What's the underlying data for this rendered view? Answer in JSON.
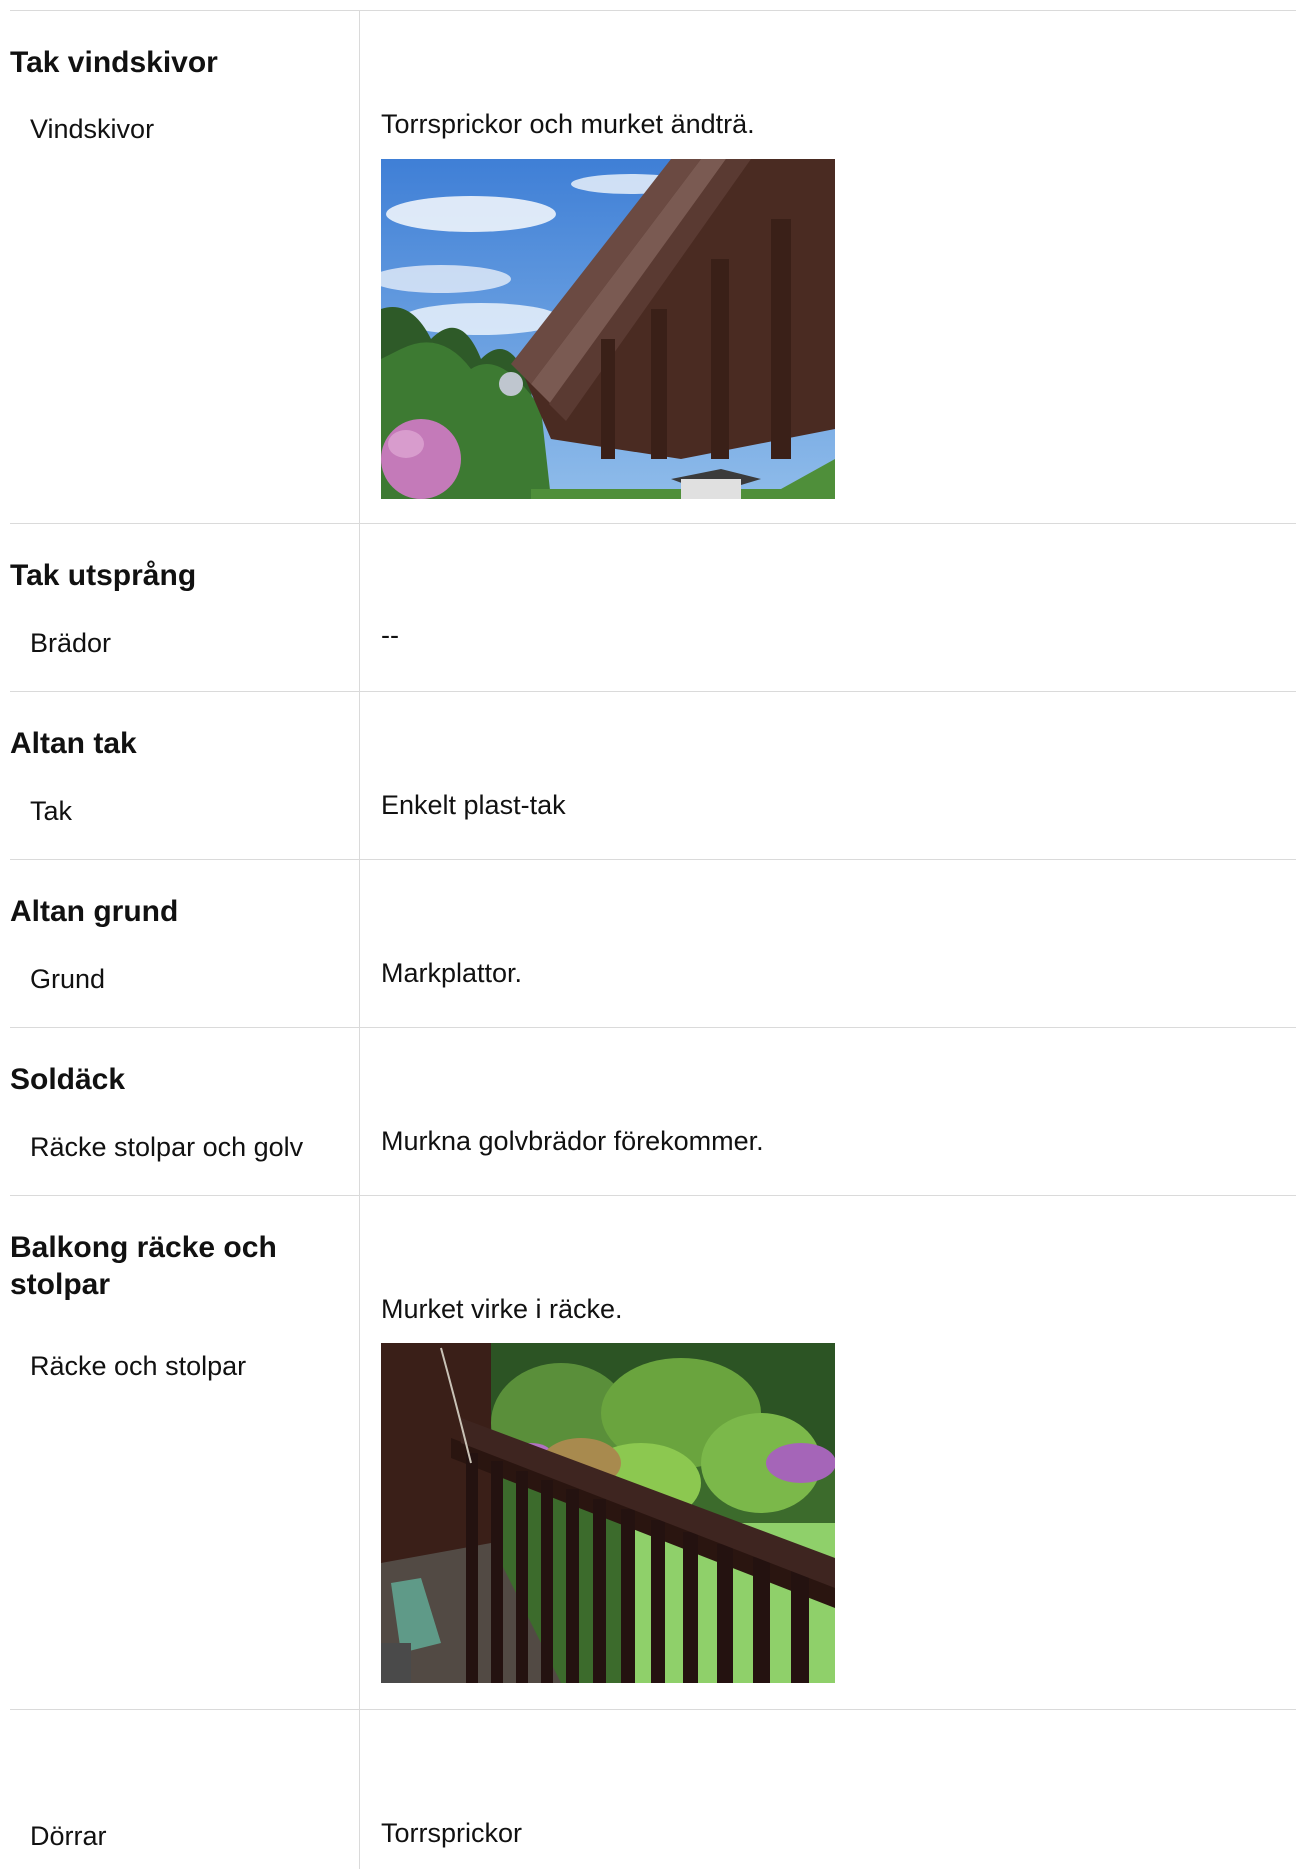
{
  "rows": [
    {
      "title": "Tak vindskivor",
      "label": "Vindskivor",
      "value": "Torrsprickor och murket ändträ.",
      "photo": "roof-eave-photo"
    },
    {
      "title": "Tak utsprång",
      "label": "Brädor",
      "value": "--"
    },
    {
      "title": "Altan tak",
      "label": "Tak",
      "value": "Enkelt plast-tak"
    },
    {
      "title": "Altan grund",
      "label": "Grund",
      "value": "Markplattor."
    },
    {
      "title": "Soldäck",
      "label": "Räcke stolpar och golv",
      "value": "Murkna golvbrädor förekommer."
    },
    {
      "title": "Balkong räcke och stolpar",
      "label": "Räcke och stolpar",
      "value": "Murket virke i räcke.",
      "photo": "balcony-railing-photo"
    },
    {
      "title": "",
      "label": "Dörrar",
      "value": "Torrsprickor"
    }
  ],
  "colors": {
    "divider": "#dadada",
    "text": "#111111",
    "background": "#ffffff"
  }
}
